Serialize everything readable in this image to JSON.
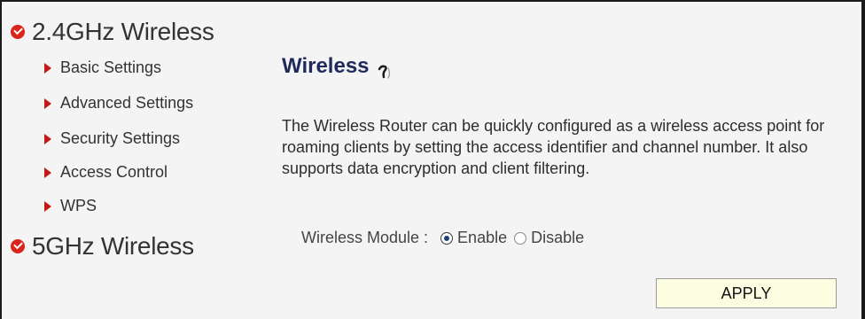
{
  "sidebar": {
    "section_24": "2.4GHz Wireless",
    "items": [
      {
        "label": "Basic Settings"
      },
      {
        "label": "Advanced Settings"
      },
      {
        "label": "Security Settings"
      },
      {
        "label": "Access Control"
      },
      {
        "label": "WPS"
      }
    ],
    "section_5": "5GHz Wireless"
  },
  "main": {
    "title": "Wireless",
    "help_icon": "help-icon",
    "description": "The Wireless Router can be quickly configured as a wireless access point for roaming clients by setting the access identifier and channel number. It also supports data encryption and client filtering.",
    "module_label": "Wireless Module :",
    "options": [
      {
        "label": "Enable",
        "selected": true
      },
      {
        "label": "Disable",
        "selected": false
      }
    ],
    "apply_label": "APPLY"
  },
  "colors": {
    "title": "#1f2a5c",
    "bullet_red": "#c41a12",
    "apply_bg": "#fdfde2"
  }
}
